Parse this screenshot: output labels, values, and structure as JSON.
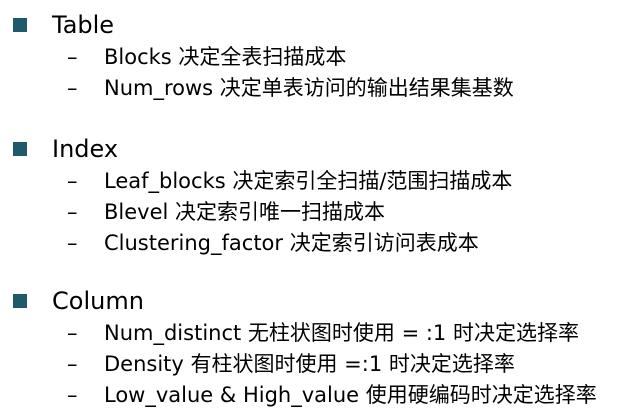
{
  "sections": [
    {
      "heading": "Table",
      "items": [
        {
          "dash": "–",
          "text": "Blocks 决定全表扫描成本"
        },
        {
          "dash": "–",
          "text": "Num_rows 决定单表访问的输出结果集基数"
        }
      ]
    },
    {
      "heading": "Index",
      "items": [
        {
          "dash": "–",
          "text": "Leaf_blocks 决定索引全扫描/范围扫描成本"
        },
        {
          "dash": "–",
          "text": "Blevel 决定索引唯一扫描成本"
        },
        {
          "dash": "–",
          "text": "Clustering_factor 决定索引访问表成本"
        }
      ]
    },
    {
      "heading": "Column",
      "items": [
        {
          "dash": "–",
          "text": "Num_distinct 无柱状图时使用 = :1 时决定选择率"
        },
        {
          "dash": "–",
          "text": "Density 有柱状图时使用 =:1 时决定选择率"
        },
        {
          "dash": "–",
          "text": "Low_value & High_value 使用硬编码时决定选择率"
        }
      ]
    }
  ],
  "colors": {
    "bullet": "#1f5a6b",
    "text": "#000000",
    "background": "#ffffff"
  },
  "icons": {
    "bullet": "square-bullet-icon"
  }
}
